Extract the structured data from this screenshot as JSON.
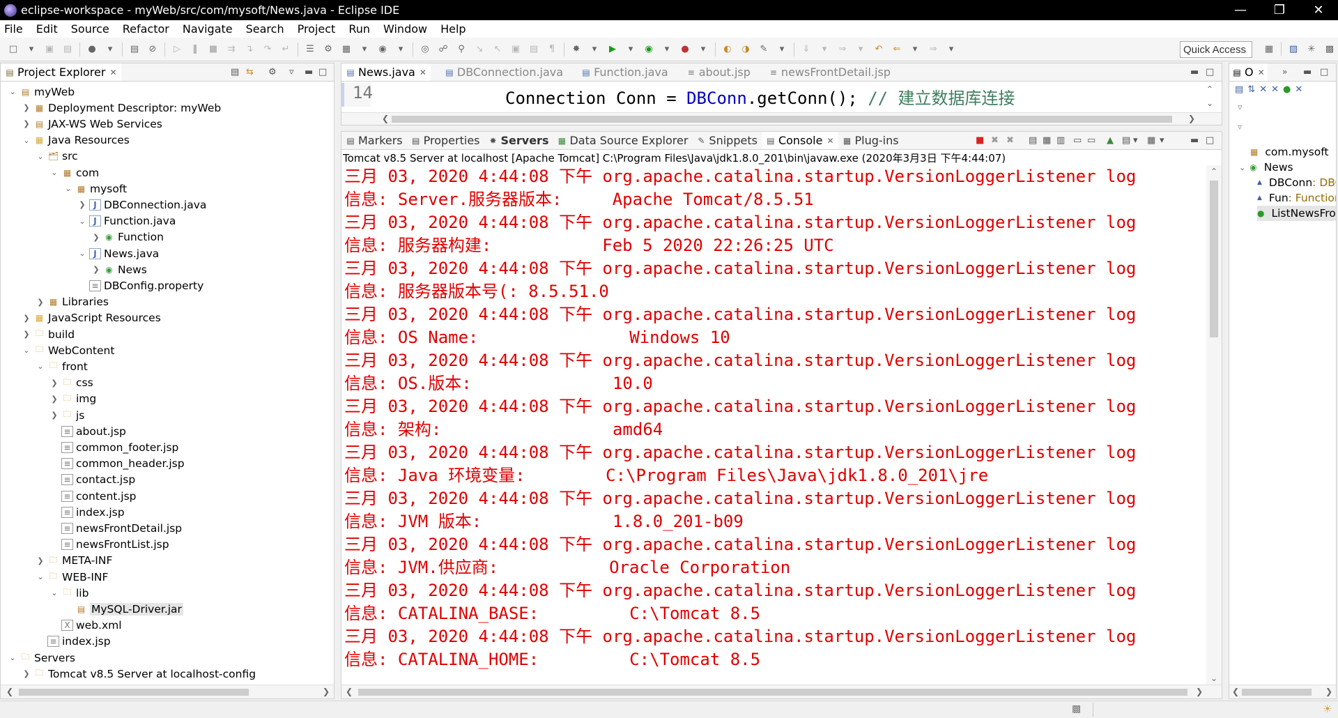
{
  "window": {
    "title": "eclipse-workspace - myWeb/src/com/mysoft/News.java - Eclipse IDE"
  },
  "menu": [
    "File",
    "Edit",
    "Source",
    "Refactor",
    "Navigate",
    "Search",
    "Project",
    "Run",
    "Window",
    "Help"
  ],
  "toolbar": {
    "quick_access": "Quick Access"
  },
  "explorer": {
    "title": "Project Explorer",
    "items": [
      {
        "label": "myWeb",
        "level": 0,
        "twisty": "v",
        "icon": "project"
      },
      {
        "label": "Deployment Descriptor: myWeb",
        "level": 1,
        "twisty": ">",
        "icon": "descriptor"
      },
      {
        "label": "JAX-WS Web Services",
        "level": 1,
        "twisty": ">",
        "icon": "webservice"
      },
      {
        "label": "Java Resources",
        "level": 1,
        "twisty": "v",
        "icon": "javares"
      },
      {
        "label": "src",
        "level": 2,
        "twisty": "v",
        "icon": "srcfolder"
      },
      {
        "label": "com",
        "level": 3,
        "twisty": "v",
        "icon": "package"
      },
      {
        "label": "mysoft",
        "level": 4,
        "twisty": "v",
        "icon": "package"
      },
      {
        "label": "DBConnection.java",
        "level": 5,
        "twisty": ">",
        "icon": "java"
      },
      {
        "label": "Function.java",
        "level": 5,
        "twisty": "v",
        "icon": "java"
      },
      {
        "label": "Function",
        "level": 6,
        "twisty": ">",
        "icon": "class"
      },
      {
        "label": "News.java",
        "level": 5,
        "twisty": "v",
        "icon": "java"
      },
      {
        "label": "News",
        "level": 6,
        "twisty": ">",
        "icon": "class"
      },
      {
        "label": "DBConfig.property",
        "level": 5,
        "twisty": "",
        "icon": "file"
      },
      {
        "label": "Libraries",
        "level": 2,
        "twisty": ">",
        "icon": "library"
      },
      {
        "label": "JavaScript Resources",
        "level": 1,
        "twisty": ">",
        "icon": "jsres"
      },
      {
        "label": "build",
        "level": 1,
        "twisty": ">",
        "icon": "folder"
      },
      {
        "label": "WebContent",
        "level": 1,
        "twisty": "v",
        "icon": "webfolder"
      },
      {
        "label": "front",
        "level": 2,
        "twisty": "v",
        "icon": "webfolder"
      },
      {
        "label": "css",
        "level": 3,
        "twisty": ">",
        "icon": "folder"
      },
      {
        "label": "img",
        "level": 3,
        "twisty": ">",
        "icon": "folder"
      },
      {
        "label": "js",
        "level": 3,
        "twisty": ">",
        "icon": "folder"
      },
      {
        "label": "about.jsp",
        "level": 3,
        "twisty": "",
        "icon": "file"
      },
      {
        "label": "common_footer.jsp",
        "level": 3,
        "twisty": "",
        "icon": "file"
      },
      {
        "label": "common_header.jsp",
        "level": 3,
        "twisty": "",
        "icon": "file"
      },
      {
        "label": "contact.jsp",
        "level": 3,
        "twisty": "",
        "icon": "file"
      },
      {
        "label": "content.jsp",
        "level": 3,
        "twisty": "",
        "icon": "file"
      },
      {
        "label": "index.jsp",
        "level": 3,
        "twisty": "",
        "icon": "file"
      },
      {
        "label": "newsFrontDetail.jsp",
        "level": 3,
        "twisty": "",
        "icon": "file-error"
      },
      {
        "label": "newsFrontList.jsp",
        "level": 3,
        "twisty": "",
        "icon": "file"
      },
      {
        "label": "META-INF",
        "level": 2,
        "twisty": ">",
        "icon": "folder"
      },
      {
        "label": "WEB-INF",
        "level": 2,
        "twisty": "v",
        "icon": "folder"
      },
      {
        "label": "lib",
        "level": 3,
        "twisty": "v",
        "icon": "folder"
      },
      {
        "label": "MySQL-Driver.jar",
        "level": 4,
        "twisty": "",
        "icon": "jar",
        "selected": true
      },
      {
        "label": "web.xml",
        "level": 3,
        "twisty": "",
        "icon": "xml"
      },
      {
        "label": "index.jsp",
        "level": 2,
        "twisty": "",
        "icon": "file"
      },
      {
        "label": "Servers",
        "level": 0,
        "twisty": "v",
        "icon": "folder"
      },
      {
        "label": "Tomcat v8.5 Server at localhost-config",
        "level": 1,
        "twisty": ">",
        "icon": "folder"
      }
    ]
  },
  "editor": {
    "tabs": [
      {
        "label": "News.java",
        "active": true,
        "closable": true
      },
      {
        "label": "DBConnection.java",
        "active": false
      },
      {
        "label": "Function.java",
        "active": false
      },
      {
        "label": "about.jsp",
        "active": false
      },
      {
        "label": "newsFrontDetail.jsp",
        "active": false
      }
    ],
    "line_number": "14",
    "code": {
      "type": "Connection",
      "var": " Conn ",
      "eq": "= ",
      "cls": "DBConn",
      "call": ".getConn(); ",
      "comment": "// 建立数据库连接"
    }
  },
  "bottom_panel": {
    "tabs": [
      {
        "label": "Markers",
        "active": false
      },
      {
        "label": "Properties",
        "active": false
      },
      {
        "label": "Servers",
        "active": false,
        "bold": true
      },
      {
        "label": "Data Source Explorer",
        "active": false
      },
      {
        "label": "Snippets",
        "active": false
      },
      {
        "label": "Console",
        "active": true,
        "closable": true
      },
      {
        "label": "Plug-ins",
        "active": false
      }
    ],
    "console_header": "Tomcat v8.5 Server at localhost [Apache Tomcat] C:\\Program Files\\Java\\jdk1.8.0_201\\bin\\javaw.exe (2020年3月3日 下午4:44:07)",
    "lines": [
      "三月 03, 2020 4:44:08 下午 org.apache.catalina.startup.VersionLoggerListener log",
      "信息: Server.服务器版本:     Apache Tomcat/8.5.51",
      "三月 03, 2020 4:44:08 下午 org.apache.catalina.startup.VersionLoggerListener log",
      "信息: 服务器构建:           Feb 5 2020 22:26:25 UTC",
      "三月 03, 2020 4:44:08 下午 org.apache.catalina.startup.VersionLoggerListener log",
      "信息: 服务器版本号(: 8.5.51.0",
      "三月 03, 2020 4:44:08 下午 org.apache.catalina.startup.VersionLoggerListener log",
      "信息: OS Name:               Windows 10",
      "三月 03, 2020 4:44:08 下午 org.apache.catalina.startup.VersionLoggerListener log",
      "信息: OS.版本:              10.0",
      "三月 03, 2020 4:44:08 下午 org.apache.catalina.startup.VersionLoggerListener log",
      "信息: 架构:                 amd64",
      "三月 03, 2020 4:44:08 下午 org.apache.catalina.startup.VersionLoggerListener log",
      "信息: Java 环境变量:        C:\\Program Files\\Java\\jdk1.8.0_201\\jre",
      "三月 03, 2020 4:44:08 下午 org.apache.catalina.startup.VersionLoggerListener log",
      "信息: JVM 版本:             1.8.0_201-b09",
      "三月 03, 2020 4:44:08 下午 org.apache.catalina.startup.VersionLoggerListener log",
      "信息: JVM.供应商:           Oracle Corporation",
      "三月 03, 2020 4:44:08 下午 org.apache.catalina.startup.VersionLoggerListener log",
      "信息: CATALINA_BASE:         C:\\Tomcat 8.5",
      "三月 03, 2020 4:44:08 下午 org.apache.catalina.startup.VersionLoggerListener log",
      "信息: CATALINA_HOME:         C:\\Tomcat 8.5"
    ]
  },
  "outline": {
    "tab_label": "O",
    "items": [
      {
        "label": "com.mysoft",
        "icon": "package",
        "twisty": ""
      },
      {
        "label": "News",
        "icon": "class",
        "twisty": "v"
      },
      {
        "label": "DBConn",
        "type": " : DBConnection",
        "icon": "field-triangle",
        "twisty": ""
      },
      {
        "label": "Fun",
        "type": " : Function",
        "icon": "field-triangle",
        "twisty": ""
      },
      {
        "label": "ListNewsFront",
        "icon": "method",
        "twisty": "",
        "selected": true
      }
    ]
  },
  "colors": {
    "console_text": "#e00000",
    "keyword_blue": "#0000c0",
    "comment_green": "#3f7f5f",
    "titlebar": "#000000"
  }
}
